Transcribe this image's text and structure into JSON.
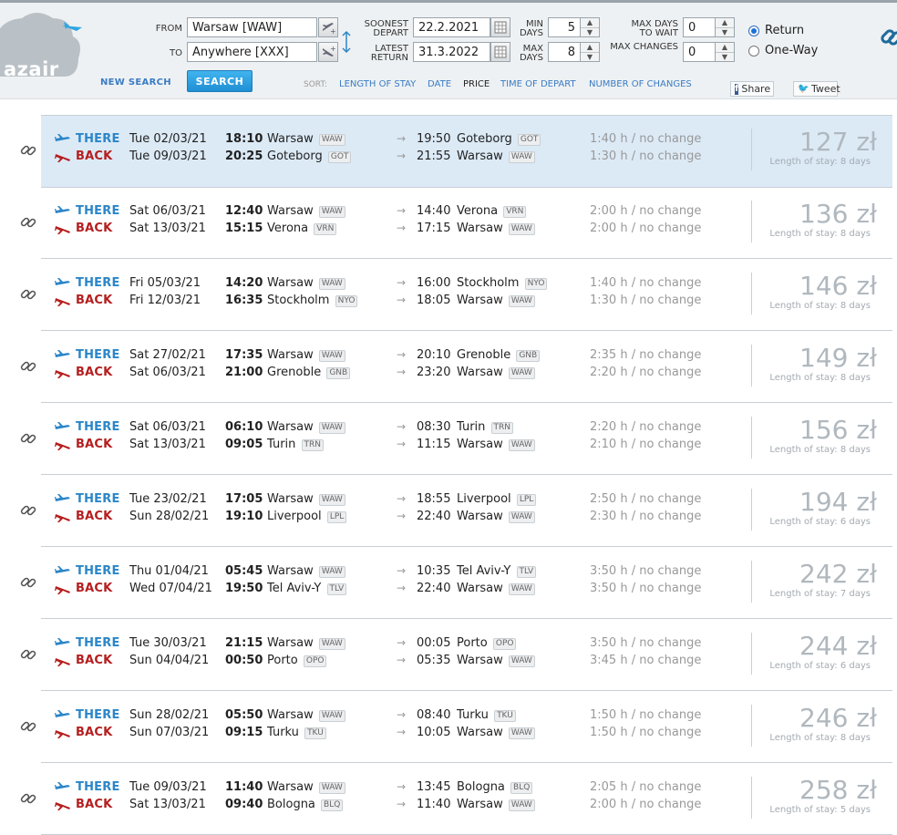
{
  "header": {
    "logo_text": "azair",
    "from_label": "FROM",
    "from_value": "Warsaw [WAW]",
    "to_label": "TO",
    "to_value": "Anywhere [XXX]",
    "soonest_depart_label_1": "SOONEST",
    "soonest_depart_label_2": "DEPART",
    "soonest_depart_value": "22.2.2021",
    "latest_return_label_1": "LATEST",
    "latest_return_label_2": "RETURN",
    "latest_return_value": "31.3.2022",
    "min_days_label_1": "MIN",
    "min_days_label_2": "DAYS",
    "min_days_value": "5",
    "max_days_label_1": "MAX",
    "max_days_label_2": "DAYS",
    "max_days_value": "8",
    "max_days_wait_label_1": "MAX DAYS",
    "max_days_wait_label_2": "TO WAIT",
    "max_days_wait_value": "0",
    "max_changes_label": "MAX CHANGES",
    "max_changes_value": "0",
    "return_label": "Return",
    "oneway_label": "One-Way",
    "trip_type_selected": "Return",
    "new_search_label": "NEW SEARCH",
    "search_label": "SEARCH",
    "sort_label": "SORT:",
    "sort_options": [
      "LENGTH OF STAY",
      "DATE",
      "PRICE",
      "TIME OF DEPART",
      "NUMBER OF CHANGES"
    ],
    "sort_active": "PRICE",
    "share_label": "Share",
    "tweet_label": "Tweet"
  },
  "colors": {
    "there": "#2b86c8",
    "back": "#b51f1f",
    "selected_row": "#dceaf6",
    "link": "#3a7cc4",
    "search_button": "#2ea0e3"
  },
  "results": [
    {
      "there": {
        "label": "THERE",
        "date": "Tue 02/03/21",
        "dep_time": "18:10",
        "dep_city": "Warsaw",
        "dep_code": "WAW",
        "arr_time": "19:50",
        "arr_city": "Goteborg",
        "arr_code": "GOT",
        "duration": "1:40 h / no change"
      },
      "back": {
        "label": "BACK",
        "date": "Tue 09/03/21",
        "dep_time": "20:25",
        "dep_city": "Goteborg",
        "dep_code": "GOT",
        "arr_time": "21:55",
        "arr_city": "Warsaw",
        "arr_code": "WAW",
        "duration": "1:30 h / no change"
      },
      "price": "127 zł",
      "stay": "Length of stay: 8 days",
      "selected": true
    },
    {
      "there": {
        "label": "THERE",
        "date": "Sat 06/03/21",
        "dep_time": "12:40",
        "dep_city": "Warsaw",
        "dep_code": "WAW",
        "arr_time": "14:40",
        "arr_city": "Verona",
        "arr_code": "VRN",
        "duration": "2:00 h / no change"
      },
      "back": {
        "label": "BACK",
        "date": "Sat 13/03/21",
        "dep_time": "15:15",
        "dep_city": "Verona",
        "dep_code": "VRN",
        "arr_time": "17:15",
        "arr_city": "Warsaw",
        "arr_code": "WAW",
        "duration": "2:00 h / no change"
      },
      "price": "136 zł",
      "stay": "Length of stay: 8 days",
      "selected": false
    },
    {
      "there": {
        "label": "THERE",
        "date": "Fri 05/03/21",
        "dep_time": "14:20",
        "dep_city": "Warsaw",
        "dep_code": "WAW",
        "arr_time": "16:00",
        "arr_city": "Stockholm",
        "arr_code": "NYO",
        "duration": "1:40 h / no change"
      },
      "back": {
        "label": "BACK",
        "date": "Fri 12/03/21",
        "dep_time": "16:35",
        "dep_city": "Stockholm",
        "dep_code": "NYO",
        "arr_time": "18:05",
        "arr_city": "Warsaw",
        "arr_code": "WAW",
        "duration": "1:30 h / no change"
      },
      "price": "146 zł",
      "stay": "Length of stay: 8 days",
      "selected": false
    },
    {
      "there": {
        "label": "THERE",
        "date": "Sat 27/02/21",
        "dep_time": "17:35",
        "dep_city": "Warsaw",
        "dep_code": "WAW",
        "arr_time": "20:10",
        "arr_city": "Grenoble",
        "arr_code": "GNB",
        "duration": "2:35 h / no change"
      },
      "back": {
        "label": "BACK",
        "date": "Sat 06/03/21",
        "dep_time": "21:00",
        "dep_city": "Grenoble",
        "dep_code": "GNB",
        "arr_time": "23:20",
        "arr_city": "Warsaw",
        "arr_code": "WAW",
        "duration": "2:20 h / no change"
      },
      "price": "149 zł",
      "stay": "Length of stay: 8 days",
      "selected": false
    },
    {
      "there": {
        "label": "THERE",
        "date": "Sat 06/03/21",
        "dep_time": "06:10",
        "dep_city": "Warsaw",
        "dep_code": "WAW",
        "arr_time": "08:30",
        "arr_city": "Turin",
        "arr_code": "TRN",
        "duration": "2:20 h / no change"
      },
      "back": {
        "label": "BACK",
        "date": "Sat 13/03/21",
        "dep_time": "09:05",
        "dep_city": "Turin",
        "dep_code": "TRN",
        "arr_time": "11:15",
        "arr_city": "Warsaw",
        "arr_code": "WAW",
        "duration": "2:10 h / no change"
      },
      "price": "156 zł",
      "stay": "Length of stay: 8 days",
      "selected": false
    },
    {
      "there": {
        "label": "THERE",
        "date": "Tue 23/02/21",
        "dep_time": "17:05",
        "dep_city": "Warsaw",
        "dep_code": "WAW",
        "arr_time": "18:55",
        "arr_city": "Liverpool",
        "arr_code": "LPL",
        "duration": "2:50 h / no change"
      },
      "back": {
        "label": "BACK",
        "date": "Sun 28/02/21",
        "dep_time": "19:10",
        "dep_city": "Liverpool",
        "dep_code": "LPL",
        "arr_time": "22:40",
        "arr_city": "Warsaw",
        "arr_code": "WAW",
        "duration": "2:30 h / no change"
      },
      "price": "194 zł",
      "stay": "Length of stay: 6 days",
      "selected": false
    },
    {
      "there": {
        "label": "THERE",
        "date": "Thu 01/04/21",
        "dep_time": "05:45",
        "dep_city": "Warsaw",
        "dep_code": "WAW",
        "arr_time": "10:35",
        "arr_city": "Tel Aviv-Y",
        "arr_code": "TLV",
        "duration": "3:50 h / no change"
      },
      "back": {
        "label": "BACK",
        "date": "Wed 07/04/21",
        "dep_time": "19:50",
        "dep_city": "Tel Aviv-Y",
        "dep_code": "TLV",
        "arr_time": "22:40",
        "arr_city": "Warsaw",
        "arr_code": "WAW",
        "duration": "3:50 h / no change"
      },
      "price": "242 zł",
      "stay": "Length of stay: 7 days",
      "selected": false
    },
    {
      "there": {
        "label": "THERE",
        "date": "Tue 30/03/21",
        "dep_time": "21:15",
        "dep_city": "Warsaw",
        "dep_code": "WAW",
        "arr_time": "00:05",
        "arr_city": "Porto",
        "arr_code": "OPO",
        "duration": "3:50 h / no change"
      },
      "back": {
        "label": "BACK",
        "date": "Sun 04/04/21",
        "dep_time": "00:50",
        "dep_city": "Porto",
        "dep_code": "OPO",
        "arr_time": "05:35",
        "arr_city": "Warsaw",
        "arr_code": "WAW",
        "duration": "3:45 h / no change"
      },
      "price": "244 zł",
      "stay": "Length of stay: 6 days",
      "selected": false
    },
    {
      "there": {
        "label": "THERE",
        "date": "Sun 28/02/21",
        "dep_time": "05:50",
        "dep_city": "Warsaw",
        "dep_code": "WAW",
        "arr_time": "08:40",
        "arr_city": "Turku",
        "arr_code": "TKU",
        "duration": "1:50 h / no change"
      },
      "back": {
        "label": "BACK",
        "date": "Sun 07/03/21",
        "dep_time": "09:15",
        "dep_city": "Turku",
        "dep_code": "TKU",
        "arr_time": "10:05",
        "arr_city": "Warsaw",
        "arr_code": "WAW",
        "duration": "1:50 h / no change"
      },
      "price": "246 zł",
      "stay": "Length of stay: 8 days",
      "selected": false
    },
    {
      "there": {
        "label": "THERE",
        "date": "Tue 09/03/21",
        "dep_time": "11:40",
        "dep_city": "Warsaw",
        "dep_code": "WAW",
        "arr_time": "13:45",
        "arr_city": "Bologna",
        "arr_code": "BLQ",
        "duration": "2:05 h / no change"
      },
      "back": {
        "label": "BACK",
        "date": "Sat 13/03/21",
        "dep_time": "09:40",
        "dep_city": "Bologna",
        "dep_code": "BLQ",
        "arr_time": "11:40",
        "arr_city": "Warsaw",
        "arr_code": "WAW",
        "duration": "2:00 h / no change"
      },
      "price": "258 zł",
      "stay": "Length of stay: 5 days",
      "selected": false
    }
  ]
}
